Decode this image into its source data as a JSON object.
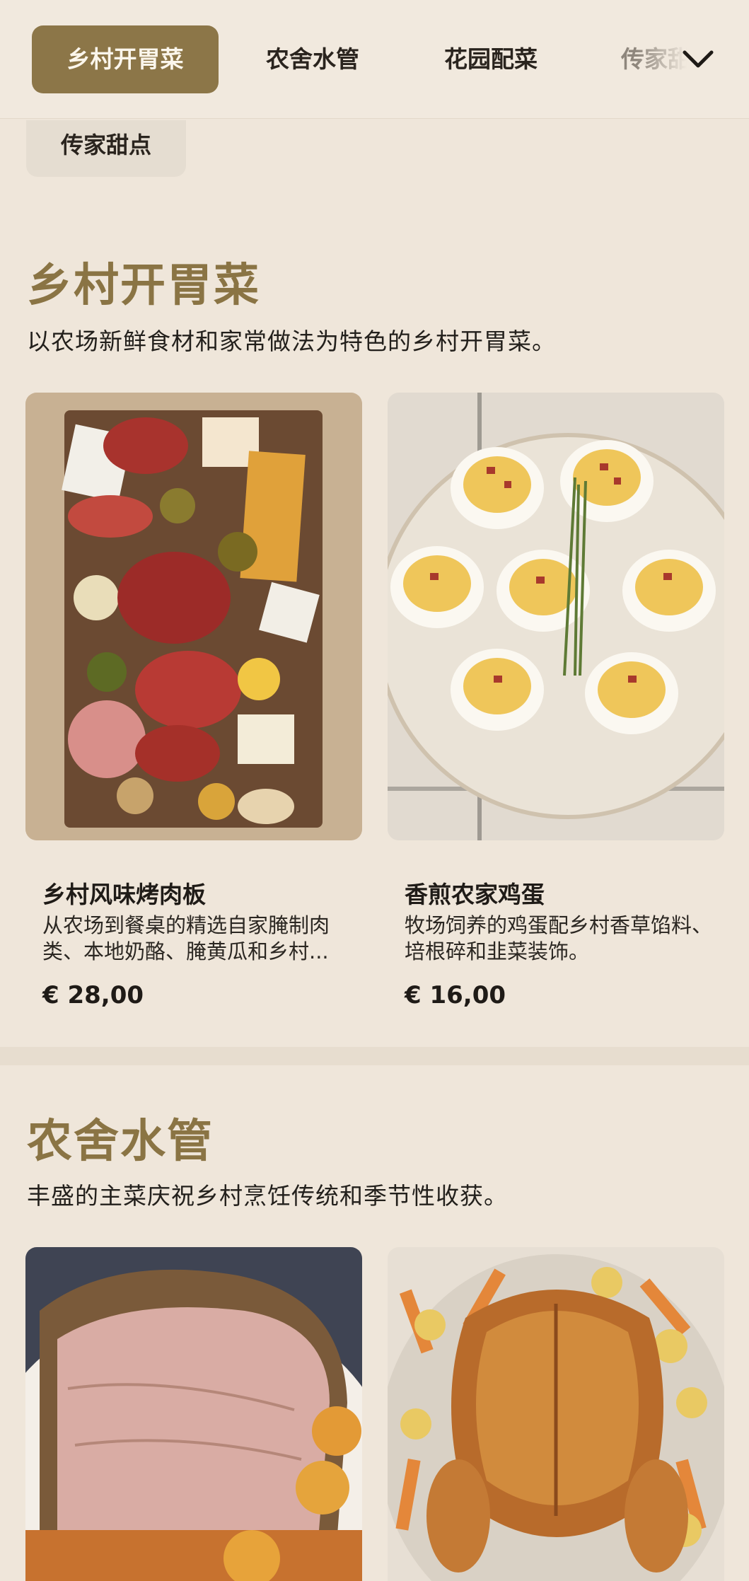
{
  "nav": {
    "tabs": [
      "乡村开胃菜",
      "农舍水管",
      "花园配菜",
      "传家甜点"
    ],
    "active_tab": "乡村开胃菜",
    "overflow_chip": "传家甜点",
    "expand_icon": "chevron-down-icon"
  },
  "sections": [
    {
      "title": "乡村开胃菜",
      "description": "以农场新鲜食材和家常做法为特色的乡村开胃菜。",
      "items": [
        {
          "name": "乡村风味烤肉板",
          "description": "从农场到餐桌的精选自家腌制肉类、本地奶酪、腌黄瓜和乡村...",
          "price": "€ 28,00",
          "image": "charcuterie-board-photo"
        },
        {
          "name": "香煎农家鸡蛋",
          "description": "牧场饲养的鸡蛋配乡村香草馅料、培根碎和韭菜装饰。",
          "price": "€ 16,00",
          "image": "deviled-eggs-photo"
        }
      ]
    },
    {
      "title": "农舍水管",
      "description": "丰盛的主菜庆祝乡村烹饪传统和季节性收获。",
      "items": [
        {
          "image": "roast-pork-photo"
        },
        {
          "image": "roast-chicken-photo"
        }
      ]
    }
  ],
  "colors": {
    "background": "#efe6da",
    "accent": "#8c7648",
    "section_title": "#8a7444"
  }
}
